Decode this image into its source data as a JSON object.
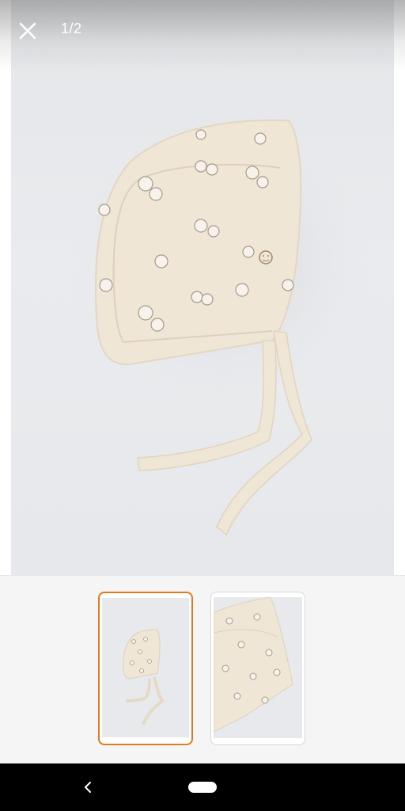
{
  "header": {
    "counter": "1/2",
    "close_icon": "close-icon"
  },
  "gallery": {
    "current_index": 1,
    "total": 2,
    "thumbnails": [
      {
        "label": "bonnet-front-thumbnail",
        "selected": true
      },
      {
        "label": "bonnet-closeup-thumbnail",
        "selected": false
      }
    ],
    "accent_color": "#e07a1f"
  },
  "system_nav": {
    "back_icon": "back-chevron-icon",
    "home_icon": "home-pill-icon"
  }
}
